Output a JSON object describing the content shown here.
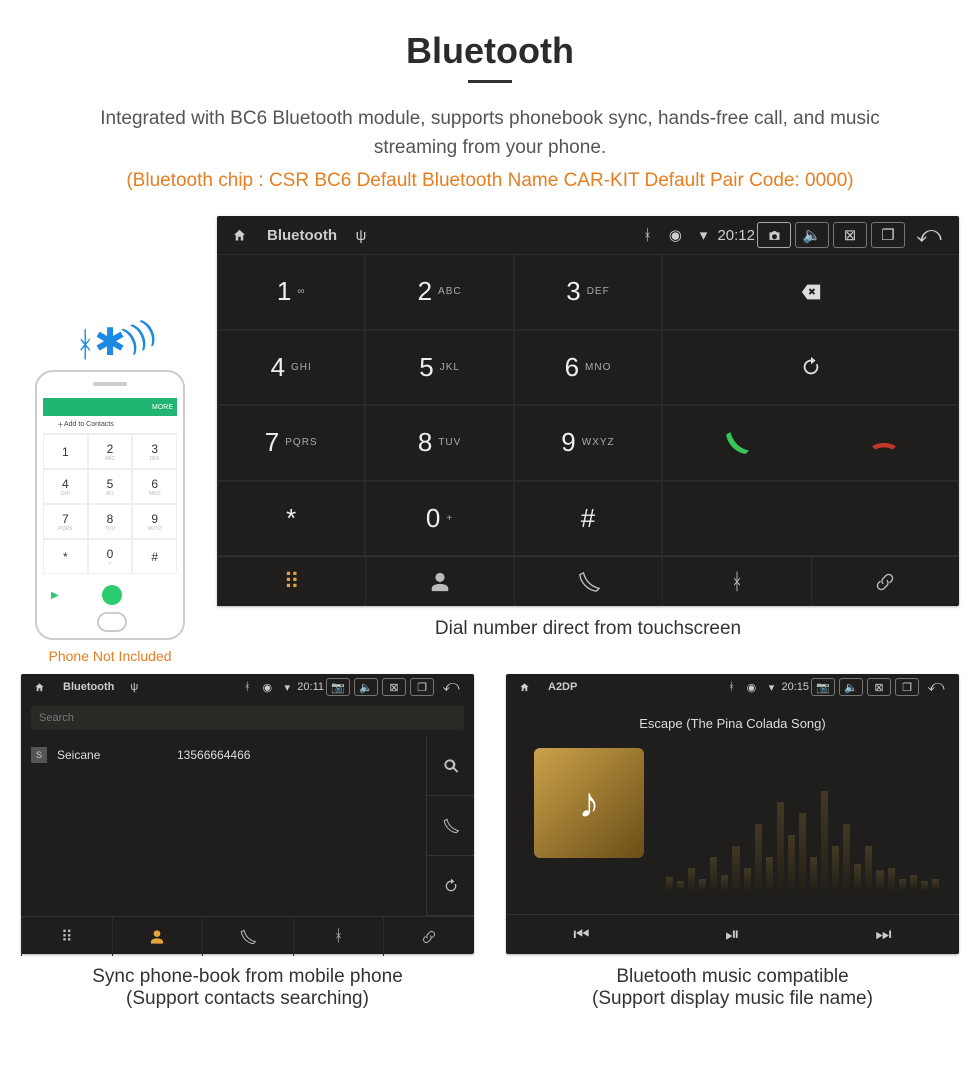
{
  "title": "Bluetooth",
  "description": "Integrated with BC6 Bluetooth module, supports phonebook sync, hands-free call, and music streaming from your phone.",
  "specs": "(Bluetooth chip : CSR BC6     Default Bluetooth Name CAR-KIT     Default Pair Code: 0000)",
  "phone_illustration": {
    "top_label": "MORE",
    "add_row": "Add to Contacts",
    "keys": [
      {
        "d": "1",
        "s": ""
      },
      {
        "d": "2",
        "s": "ABC"
      },
      {
        "d": "3",
        "s": "DEF"
      },
      {
        "d": "4",
        "s": "GHI"
      },
      {
        "d": "5",
        "s": "JKL"
      },
      {
        "d": "6",
        "s": "MNO"
      },
      {
        "d": "7",
        "s": "PQRS"
      },
      {
        "d": "8",
        "s": "TUV"
      },
      {
        "d": "9",
        "s": "WXYZ"
      },
      {
        "d": "*",
        "s": ""
      },
      {
        "d": "0",
        "s": "+"
      },
      {
        "d": "#",
        "s": ""
      }
    ],
    "caption": "Phone Not Included"
  },
  "dialer": {
    "status": {
      "title": "Bluetooth",
      "time": "20:12"
    },
    "keys": [
      {
        "digit": "1",
        "sub": "∞"
      },
      {
        "digit": "2",
        "sub": "ABC"
      },
      {
        "digit": "3",
        "sub": "DEF"
      },
      {
        "digit": "4",
        "sub": "GHI"
      },
      {
        "digit": "5",
        "sub": "JKL"
      },
      {
        "digit": "6",
        "sub": "MNO"
      },
      {
        "digit": "7",
        "sub": "PQRS"
      },
      {
        "digit": "8",
        "sub": "TUV"
      },
      {
        "digit": "9",
        "sub": "WXYZ"
      },
      {
        "digit": "*",
        "sub": ""
      },
      {
        "digit": "0",
        "sub": "+"
      },
      {
        "digit": "#",
        "sub": ""
      }
    ],
    "caption": "Dial number direct from touchscreen"
  },
  "contacts": {
    "status": {
      "title": "Bluetooth",
      "time": "20:11"
    },
    "search_placeholder": "Search",
    "rows": [
      {
        "badge": "S",
        "name": "Seicane",
        "number": "13566664466"
      }
    ],
    "caption_line1": "Sync phone-book from mobile phone",
    "caption_line2": "(Support contacts searching)"
  },
  "music": {
    "status": {
      "title": "A2DP",
      "time": "20:15"
    },
    "song": "Escape (The Pina Colada Song)",
    "caption_line1": "Bluetooth music compatible",
    "caption_line2": "(Support display music file name)"
  }
}
